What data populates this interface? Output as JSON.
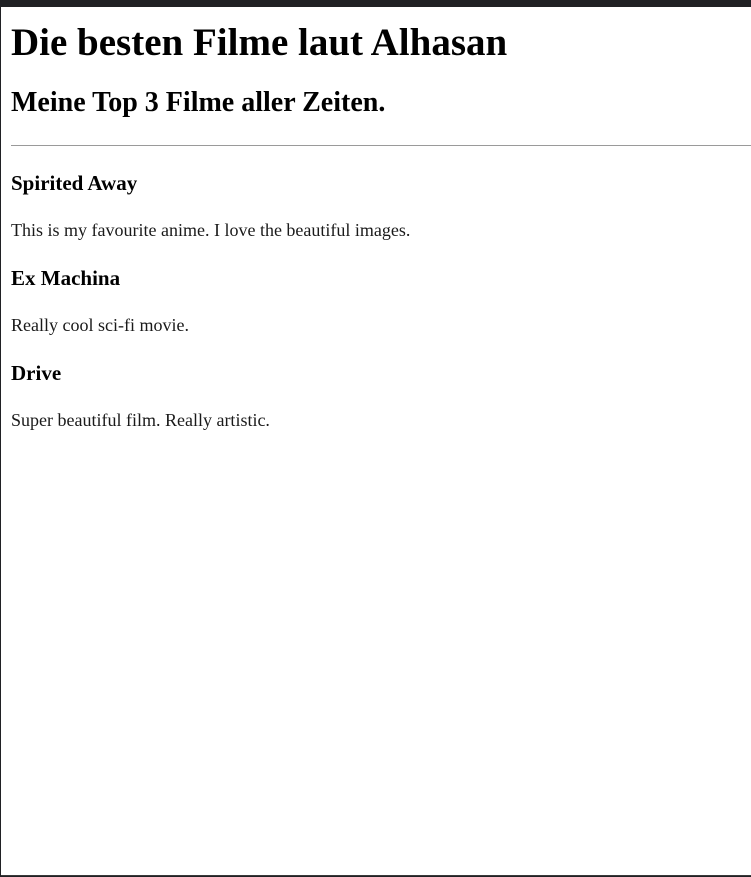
{
  "page": {
    "title": "Die besten Filme laut Alhasan",
    "subtitle": "Meine Top 3 Filme aller Zeiten."
  },
  "movies": [
    {
      "title": "Spirited Away",
      "description": "This is my favourite anime. I love the beautiful images."
    },
    {
      "title": "Ex Machina",
      "description": "Really cool sci-fi movie."
    },
    {
      "title": "Drive",
      "description": "Super beautiful film. Really artistic."
    }
  ]
}
